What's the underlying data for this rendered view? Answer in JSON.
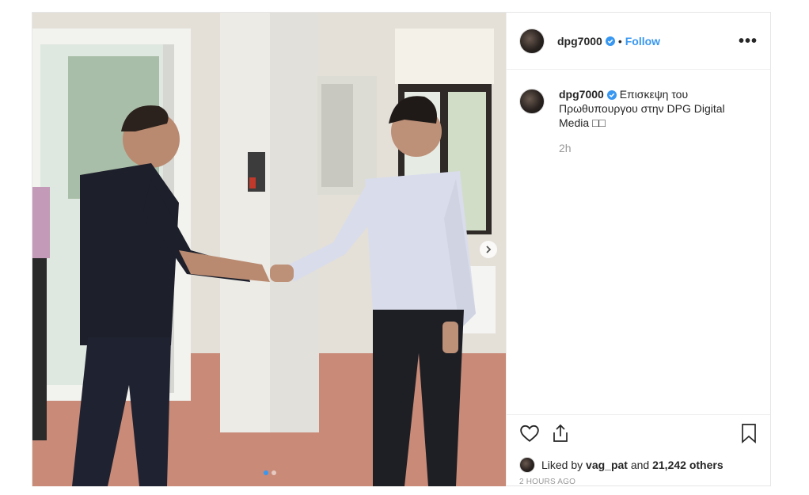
{
  "post": {
    "photo": {
      "alt_semantic": "photo-handshake",
      "carousel": {
        "current": 1,
        "total": 2
      }
    },
    "header": {
      "username": "dpg7000",
      "separator": "•",
      "follow_label": "Follow",
      "more_label": "•••"
    },
    "caption": {
      "username": "dpg7000",
      "text": "Επισκεψη του Πρωθυπουργου στην DPG Digital Media □□",
      "relative_time": "2h"
    },
    "likes": {
      "prefix": "Liked by",
      "user": "vag_pat",
      "joiner": "and",
      "others": "21,242 others"
    },
    "date": "2 HOURS AGO"
  },
  "colors": {
    "accent": "#3897f0",
    "text": "#262626",
    "muted": "#999999",
    "border": "#efefef"
  },
  "icons": [
    "verified-badge-icon",
    "more-options-icon",
    "heart-icon",
    "share-icon",
    "bookmark-icon",
    "chevron-right-icon"
  ]
}
